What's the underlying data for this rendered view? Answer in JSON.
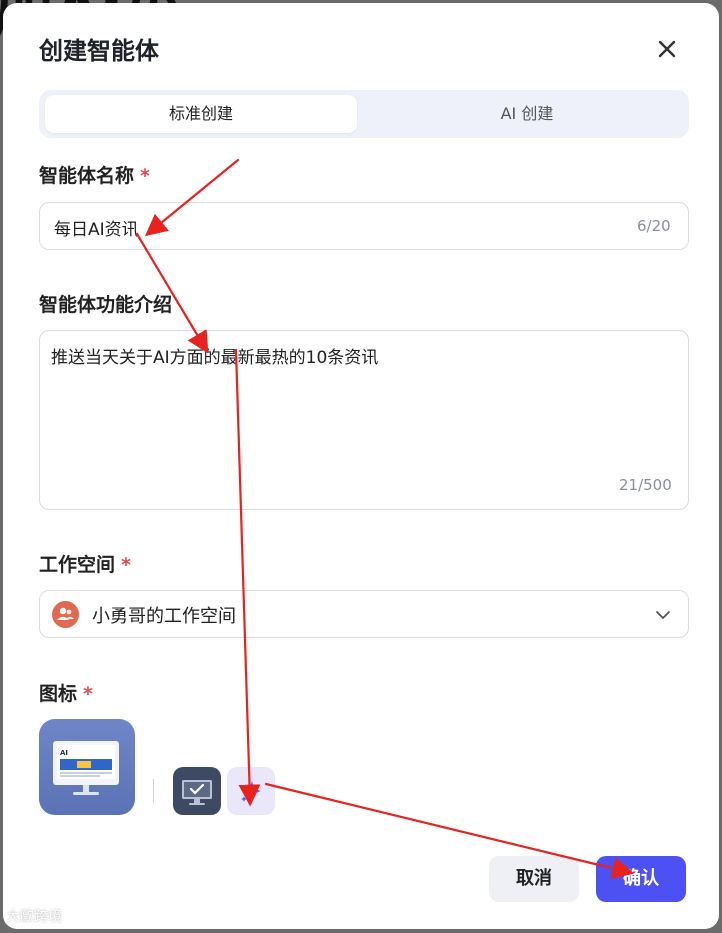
{
  "dialog": {
    "title": "创建智能体"
  },
  "tabs": [
    {
      "label": "标准创建",
      "active": true
    },
    {
      "label": "AI 创建",
      "active": false
    }
  ],
  "name_field": {
    "label": "智能体名称",
    "required_mark": "*",
    "value": "每日AI资讯",
    "counter": "6/20"
  },
  "desc_field": {
    "label": "智能体功能介绍",
    "value": "推送当天关于AI方面的最新最热的10条资讯",
    "counter": "21/500"
  },
  "workspace_field": {
    "label": "工作空间",
    "required_mark": "*",
    "value": "小勇哥的工作空间",
    "avatar_icon": "users-icon",
    "dropdown_icon": "chevron-down-icon"
  },
  "icon_field": {
    "label": "图标",
    "required_mark": "*",
    "selected_icon": "computer-screen-image",
    "options": [
      "computer-check-image",
      "sparkle-icon"
    ]
  },
  "buttons": {
    "cancel": "取消",
    "confirm": "确认"
  },
  "watermark": "大歐跨境",
  "colors": {
    "primary": "#4d50f2",
    "required": "#e5484d",
    "annotation": "#e8231f"
  }
}
